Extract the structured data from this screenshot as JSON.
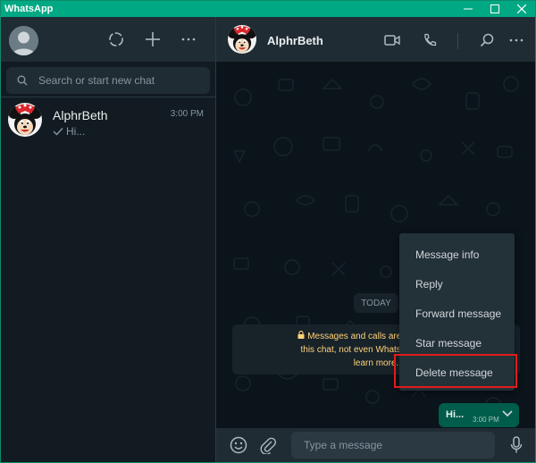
{
  "window": {
    "title": "WhatsApp"
  },
  "left_panel": {
    "search": {
      "placeholder": "Search or start new chat"
    },
    "chats": [
      {
        "name": "AlphrBeth",
        "time": "3:00 PM",
        "preview": "Hi..."
      }
    ]
  },
  "conversation": {
    "contact_name": "AlphrBeth",
    "date_label": "TODAY",
    "encryption_notice": "Messages and calls are end-to-end encrypted. No one outside of this chat, not even WhatsApp, can read or listen to them. Click to learn more.",
    "encryption_line1": "Messages and calls are end-to-end e",
    "encryption_line2": "this chat, not even WhatsApp, can rea",
    "encryption_line3": "learn more.",
    "message": {
      "text": "Hi...",
      "time": "3:00 PM"
    },
    "composer": {
      "placeholder": "Type a message"
    }
  },
  "context_menu": {
    "items": [
      "Message info",
      "Reply",
      "Forward message",
      "Star message",
      "Delete message"
    ],
    "highlighted": "Delete message"
  },
  "colors": {
    "accent": "#00a884",
    "panel_bg": "#111b21",
    "header_bg": "#202c33",
    "outgoing_bubble": "#005c4b",
    "highlight_border": "#e21b1b"
  }
}
